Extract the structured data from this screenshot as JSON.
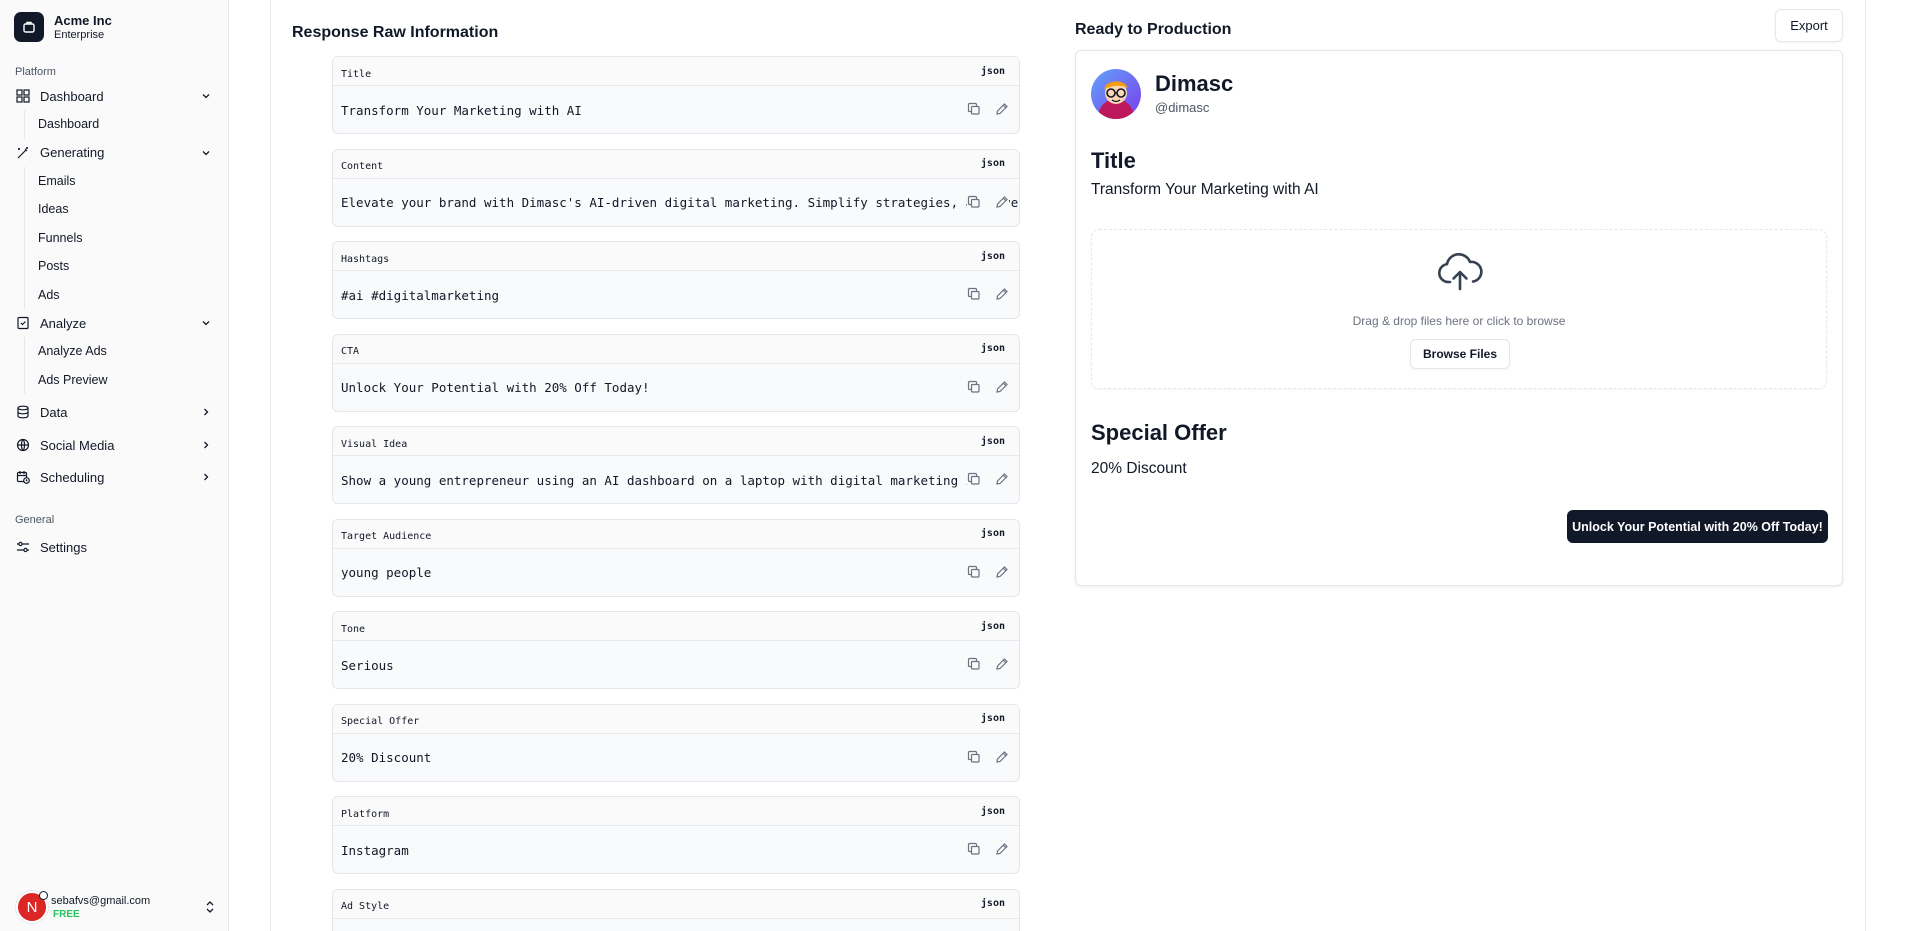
{
  "org": {
    "name": "Acme Inc",
    "plan": "Enterprise",
    "logo_icon": "command-icon"
  },
  "sidebar": {
    "platform_label": "Platform",
    "dashboard": {
      "label": "Dashboard",
      "icon": "layout-dashboard-icon",
      "children": [
        "Dashboard"
      ]
    },
    "generating": {
      "label": "Generating",
      "icon": "wand-icon",
      "children": [
        "Emails",
        "Ideas",
        "Funnels",
        "Posts",
        "Ads"
      ]
    },
    "analyze": {
      "label": "Analyze",
      "icon": "clipboard-check-icon",
      "children": [
        "Analyze Ads",
        "Ads Preview"
      ]
    },
    "data": {
      "label": "Data",
      "icon": "database-icon"
    },
    "social_media": {
      "label": "Social Media",
      "icon": "globe-icon"
    },
    "scheduling": {
      "label": "Scheduling",
      "icon": "calendar-clock-icon"
    },
    "general_label": "General",
    "settings": {
      "label": "Settings",
      "icon": "sliders-icon"
    }
  },
  "user": {
    "initial": "N",
    "email": "sebafvs@gmail.com",
    "plan": "FREE"
  },
  "raw": {
    "title": "Response Raw Information",
    "fields": [
      {
        "label": "Title",
        "lang": "json",
        "value": "Transform Your Marketing with AI"
      },
      {
        "label": "Content",
        "lang": "json",
        "value": "Elevate your brand with Dimasc's AI-driven digital marketing. Simplify strategies, achieve"
      },
      {
        "label": "Hashtags",
        "lang": "json",
        "value": "#ai #digitalmarketing"
      },
      {
        "label": "CTA",
        "lang": "json",
        "value": "Unlock Your Potential with 20% Off Today!"
      },
      {
        "label": "Visual Idea",
        "lang": "json",
        "value": "Show a young entrepreneur using an AI dashboard on a laptop with digital marketing icons"
      },
      {
        "label": "Target Audience",
        "lang": "json",
        "value": "young people"
      },
      {
        "label": "Tone",
        "lang": "json",
        "value": "Serious"
      },
      {
        "label": "Special Offer",
        "lang": "json",
        "value": "20% Discount"
      },
      {
        "label": "Platform",
        "lang": "json",
        "value": "Instagram"
      },
      {
        "label": "Ad Style",
        "lang": "json",
        "value": ""
      }
    ]
  },
  "preview": {
    "title": "Ready to Production",
    "export_label": "Export",
    "profile_name": "Dimasc",
    "profile_handle": "@dimasc",
    "title_heading": "Title",
    "title_text": "Transform Your Marketing with AI",
    "drop_text": "Drag & drop files here or click to browse",
    "browse_label": "Browse Files",
    "offer_heading": "Special Offer",
    "offer_text": "20% Discount",
    "cta_label": "Unlock Your Potential with 20% Off Today!"
  },
  "colors": {
    "primary": "#111827",
    "accent_free": "#22c55e",
    "avatar_red": "#dc2626",
    "border": "#e5e7eb"
  }
}
